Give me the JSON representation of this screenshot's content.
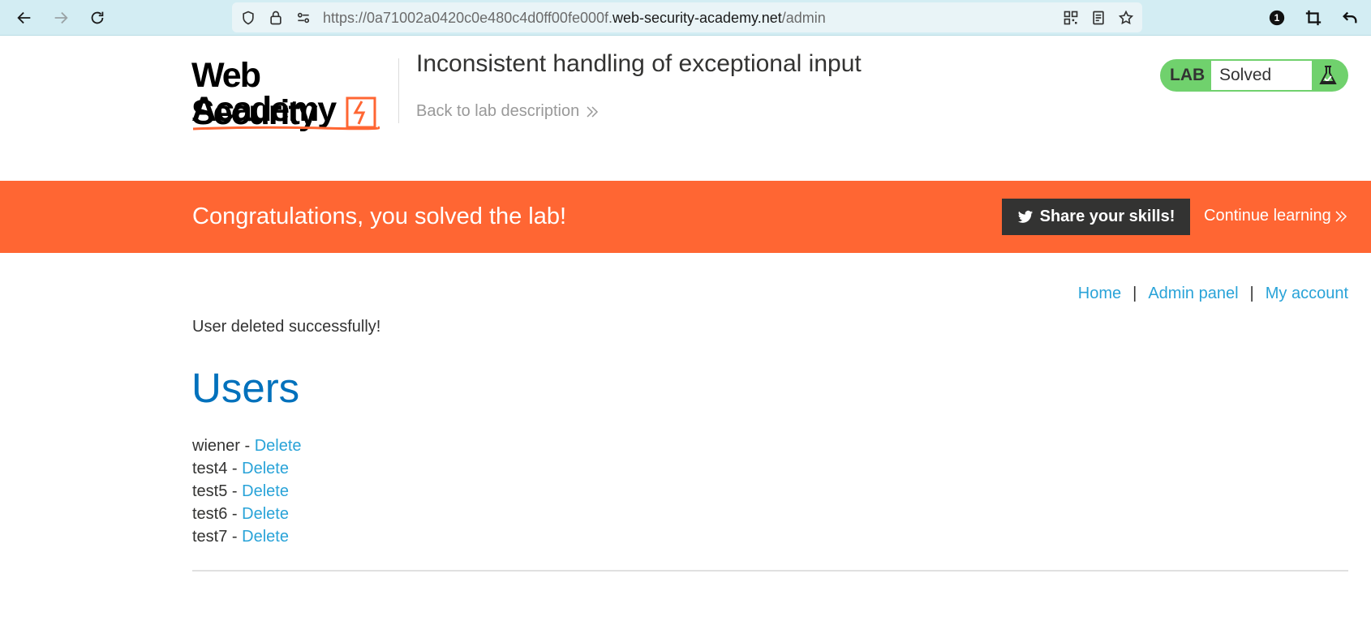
{
  "browser": {
    "url_prefix": "https://0a71002a0420c0e480c4d0ff00fe000f.",
    "url_host": "web-security-academy.net",
    "url_path": "/admin",
    "badge_count": "1"
  },
  "header": {
    "logo_line1": "Web Security",
    "logo_line2": "Academy",
    "lab_title": "Inconsistent handling of exceptional input",
    "back_link": "Back to lab description",
    "lab_label": "LAB",
    "lab_status": "Solved"
  },
  "banner": {
    "message": "Congratulations, you solved the lab!",
    "share_button": "Share your skills!",
    "continue_link": "Continue learning"
  },
  "nav": {
    "home": "Home",
    "separator": "|",
    "admin_panel": "Admin panel",
    "my_account": "My account"
  },
  "content": {
    "message": "User deleted successfully!",
    "heading": "Users",
    "dash": " - ",
    "users": [
      {
        "name": "wiener",
        "action": "Delete"
      },
      {
        "name": "test4",
        "action": "Delete"
      },
      {
        "name": "test5",
        "action": "Delete"
      },
      {
        "name": "test6",
        "action": "Delete"
      },
      {
        "name": "test7",
        "action": "Delete"
      }
    ]
  },
  "colors": {
    "banner": "#ff6633",
    "link": "#29a3d8",
    "heading": "#0071bc",
    "lab_solved": "#70d16d"
  }
}
